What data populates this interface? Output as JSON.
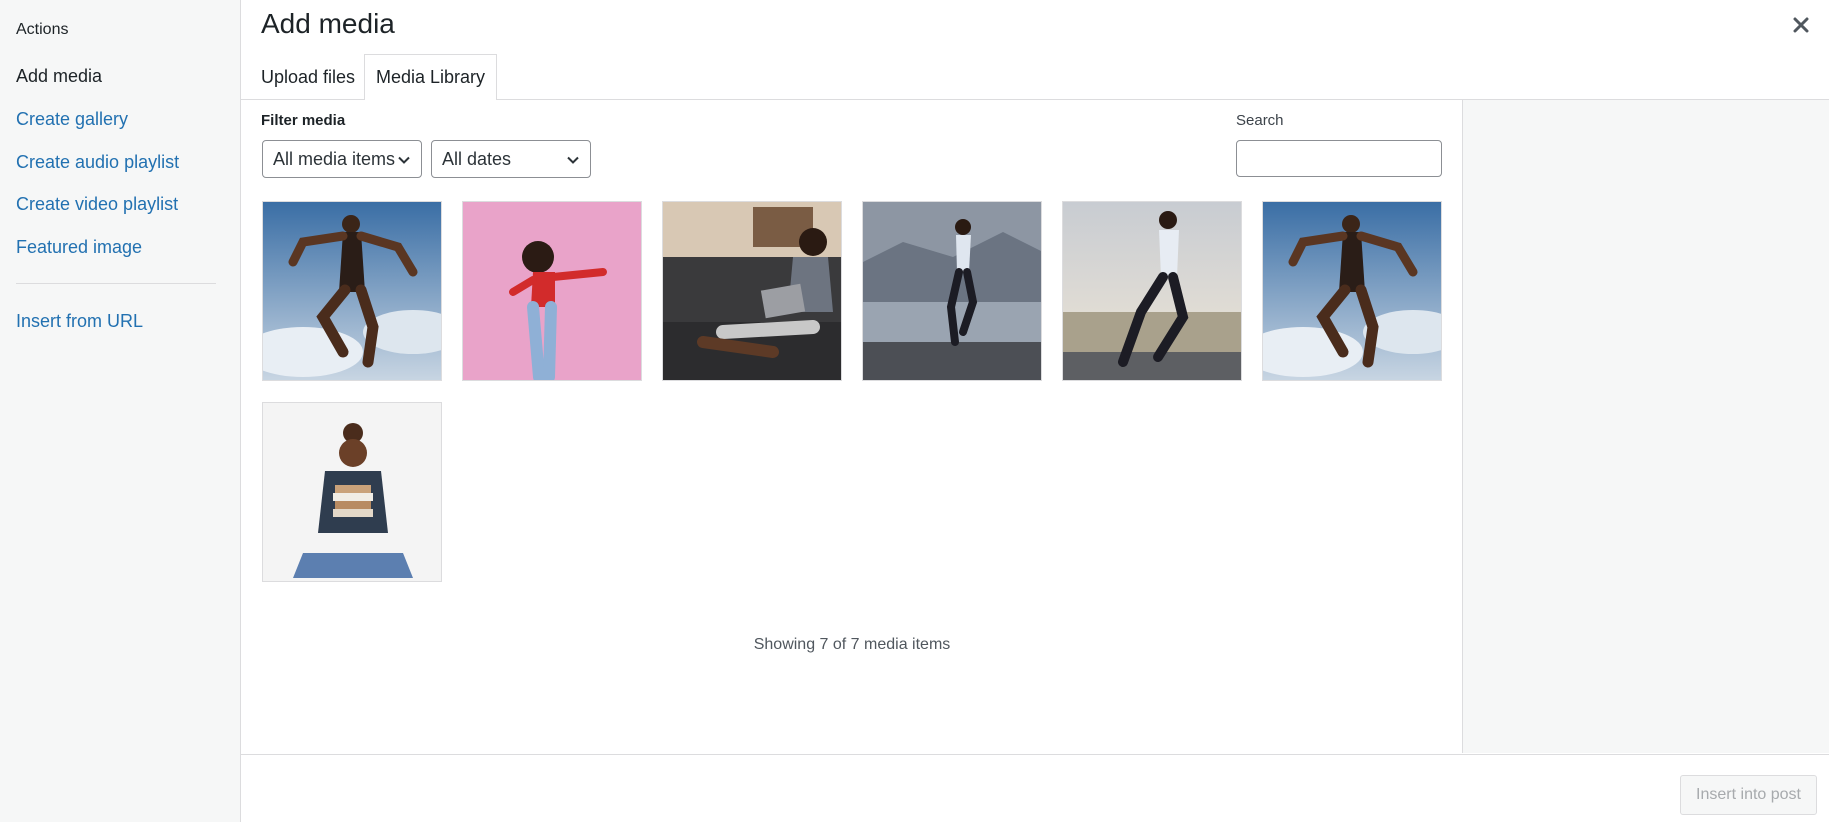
{
  "menu": {
    "heading": "Actions",
    "items": [
      {
        "label": "Add media"
      },
      {
        "label": "Create gallery"
      },
      {
        "label": "Create audio playlist"
      },
      {
        "label": "Create video playlist"
      },
      {
        "label": "Featured image"
      },
      {
        "label": "Insert from URL"
      }
    ]
  },
  "header": {
    "title": "Add media",
    "tabs": [
      {
        "label": "Upload files"
      },
      {
        "label": "Media Library"
      }
    ]
  },
  "filter": {
    "label": "Filter media",
    "type_select": "All media items",
    "date_select": "All dates"
  },
  "search": {
    "label": "Search",
    "value": ""
  },
  "media": [
    {
      "name": "jumping-man-sky"
    },
    {
      "name": "woman-dancing-pink"
    },
    {
      "name": "boy-with-tablet"
    },
    {
      "name": "man-running-city"
    },
    {
      "name": "man-running-sunset"
    },
    {
      "name": "jumping-man-sky"
    },
    {
      "name": "girl-holding-books"
    }
  ],
  "status": {
    "count_text": "Showing 7 of 7 media items"
  },
  "toolbar": {
    "insert_label": "Insert into post"
  },
  "colors": {
    "link": "#2271b1",
    "text": "#1d2327",
    "border": "#dcdcde",
    "sidebar_bg": "#f6f7f7"
  }
}
